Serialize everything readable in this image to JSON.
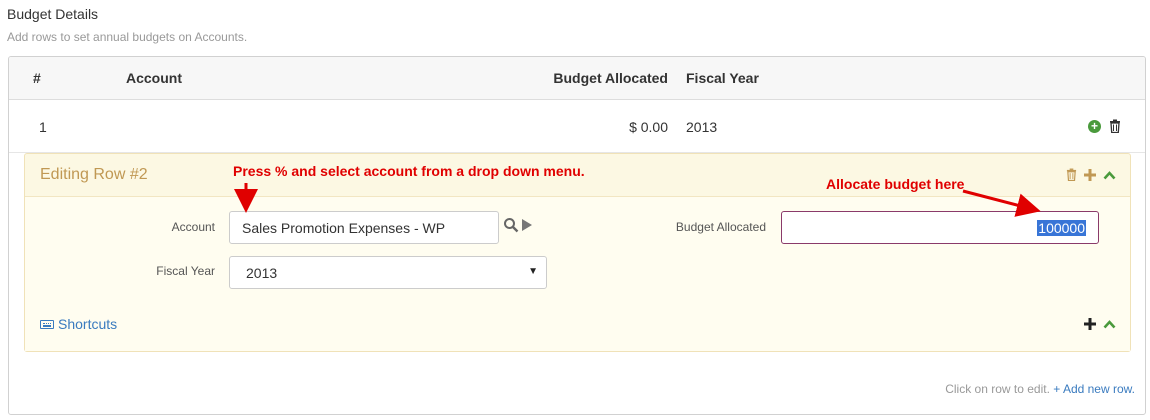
{
  "section": {
    "title": "Budget Details",
    "description": "Add rows to set annual budgets on Accounts."
  },
  "table": {
    "headers": {
      "index": "#",
      "account": "Account",
      "budget": "Budget Allocated",
      "fiscal_year": "Fiscal Year"
    },
    "rows": [
      {
        "index": "1",
        "account": "",
        "budget": "$ 0.00",
        "fiscal_year": "2013"
      }
    ]
  },
  "edit_row": {
    "title": "Editing Row #2",
    "account_label": "Account",
    "account_value": "Sales Promotion Expenses - WP",
    "fiscal_year_label": "Fiscal Year",
    "fiscal_year_value": "2013",
    "budget_label": "Budget Allocated",
    "budget_value": "100000",
    "shortcuts_label": "Shortcuts"
  },
  "footer": {
    "hint": "Click on row to edit.",
    "add_link": "+ Add new row."
  },
  "annotations": {
    "account_hint": "Press % and select account from a drop down menu.",
    "budget_hint": "Allocate budget here"
  },
  "icons": {
    "add_row": "plus-circle-icon",
    "delete_row": "trash-icon",
    "insert": "plus-icon",
    "collapse": "chevron-up-icon",
    "search": "search-icon",
    "open": "play-icon",
    "keyboard": "keyboard-icon"
  },
  "colors": {
    "accent_green": "#4a9a3c",
    "edit_title": "#c09853",
    "link": "#3a7bbf",
    "annotation": "#e00000"
  }
}
